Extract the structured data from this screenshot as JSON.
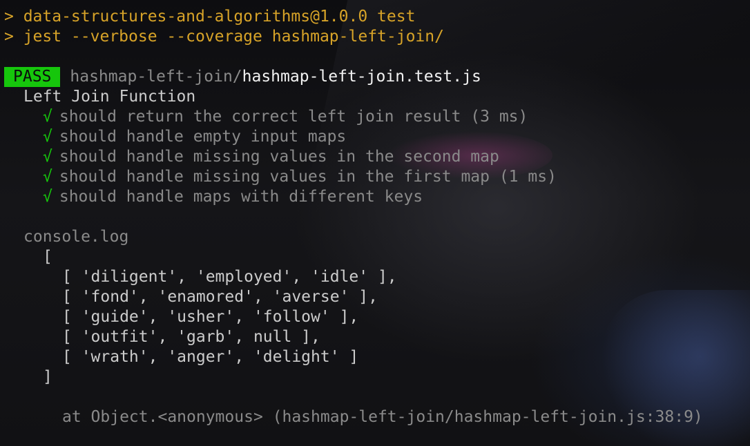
{
  "header": {
    "prompt_1": "> data-structures-and-algorithms@1.0.0 test",
    "prompt_2": "> jest --verbose --coverage hashmap-left-join/"
  },
  "result": {
    "badge": "PASS",
    "path_dir": "hashmap-left-join/",
    "path_file": "hashmap-left-join.test.js"
  },
  "suite": {
    "title": "Left Join Function",
    "tests": [
      {
        "check": "√",
        "name": "should return the correct left join result (3 ms)"
      },
      {
        "check": "√",
        "name": "should handle empty input maps"
      },
      {
        "check": "√",
        "name": "should handle missing values in the second map"
      },
      {
        "check": "√",
        "name": "should handle missing values in the first map (1 ms)"
      },
      {
        "check": "√",
        "name": "should handle maps with different keys"
      }
    ]
  },
  "console": {
    "label": "console.log",
    "open": "[",
    "rows": [
      "[ 'diligent', 'employed', 'idle' ],",
      "[ 'fond', 'enamored', 'averse' ],",
      "[ 'guide', 'usher', 'follow' ],",
      "[ 'outfit', 'garb', null ],",
      "[ 'wrath', 'anger', 'delight' ]"
    ],
    "close": "]",
    "location": "at Object.<anonymous> (hashmap-left-join/hashmap-left-join.js:38:9)"
  },
  "colors": {
    "background": "#0b0b0d",
    "command": "#d7a328",
    "pass": "#16c60c",
    "dim_text": "#8a8a8a",
    "bright_text": "#f2f2f2"
  }
}
